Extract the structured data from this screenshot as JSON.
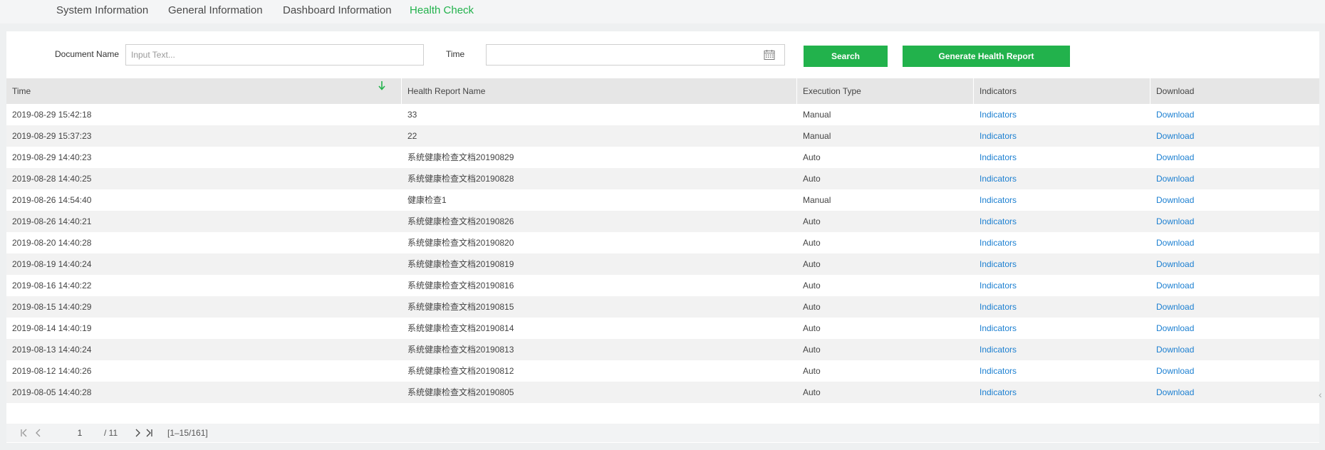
{
  "nav": {
    "tabs": [
      {
        "label": "System Information"
      },
      {
        "label": "General Information"
      },
      {
        "label": "Dashboard Information"
      },
      {
        "label": "Health Check"
      }
    ],
    "active_tab": "Health Check"
  },
  "filters": {
    "document_name_label": "Document Name",
    "document_name_placeholder": "Input Text...",
    "document_name_value": "",
    "time_label": "Time",
    "time_value": "",
    "search_label": "Search",
    "generate_label": "Generate Health Report"
  },
  "table": {
    "columns": [
      "Time",
      "Health Report Name",
      "Execution Type",
      "Indicators",
      "Download"
    ],
    "sort_icon": "arrow-down-icon",
    "rows": [
      {
        "time": "2019-08-29 15:42:18",
        "name": "33",
        "type": "Manual",
        "indicators": "Indicators",
        "download": "Download"
      },
      {
        "time": "2019-08-29 15:37:23",
        "name": "22",
        "type": "Manual",
        "indicators": "Indicators",
        "download": "Download"
      },
      {
        "time": "2019-08-29 14:40:23",
        "name": "系统健康检查文档20190829",
        "type": "Auto",
        "indicators": "Indicators",
        "download": "Download"
      },
      {
        "time": "2019-08-28 14:40:25",
        "name": "系统健康检查文档20190828",
        "type": "Auto",
        "indicators": "Indicators",
        "download": "Download"
      },
      {
        "time": "2019-08-26 14:54:40",
        "name": "健康检查1",
        "type": "Manual",
        "indicators": "Indicators",
        "download": "Download"
      },
      {
        "time": "2019-08-26 14:40:21",
        "name": "系统健康检查文档20190826",
        "type": "Auto",
        "indicators": "Indicators",
        "download": "Download"
      },
      {
        "time": "2019-08-20 14:40:28",
        "name": "系统健康检查文档20190820",
        "type": "Auto",
        "indicators": "Indicators",
        "download": "Download"
      },
      {
        "time": "2019-08-19 14:40:24",
        "name": "系统健康检查文档20190819",
        "type": "Auto",
        "indicators": "Indicators",
        "download": "Download"
      },
      {
        "time": "2019-08-16 14:40:22",
        "name": "系统健康检查文档20190816",
        "type": "Auto",
        "indicators": "Indicators",
        "download": "Download"
      },
      {
        "time": "2019-08-15 14:40:29",
        "name": "系统健康检查文档20190815",
        "type": "Auto",
        "indicators": "Indicators",
        "download": "Download"
      },
      {
        "time": "2019-08-14 14:40:19",
        "name": "系统健康检查文档20190814",
        "type": "Auto",
        "indicators": "Indicators",
        "download": "Download"
      },
      {
        "time": "2019-08-13 14:40:24",
        "name": "系统健康检查文档20190813",
        "type": "Auto",
        "indicators": "Indicators",
        "download": "Download"
      },
      {
        "time": "2019-08-12 14:40:26",
        "name": "系统健康检查文档20190812",
        "type": "Auto",
        "indicators": "Indicators",
        "download": "Download"
      },
      {
        "time": "2019-08-05 14:40:28",
        "name": "系统健康检查文档20190805",
        "type": "Auto",
        "indicators": "Indicators",
        "download": "Download"
      }
    ]
  },
  "pagination": {
    "current_page": "1",
    "total_pages": "/ 11",
    "range": "[1–15/161]"
  },
  "colors": {
    "accent": "#22b24c",
    "link": "#1b7fd1",
    "header_bg": "#e6e6e6"
  }
}
